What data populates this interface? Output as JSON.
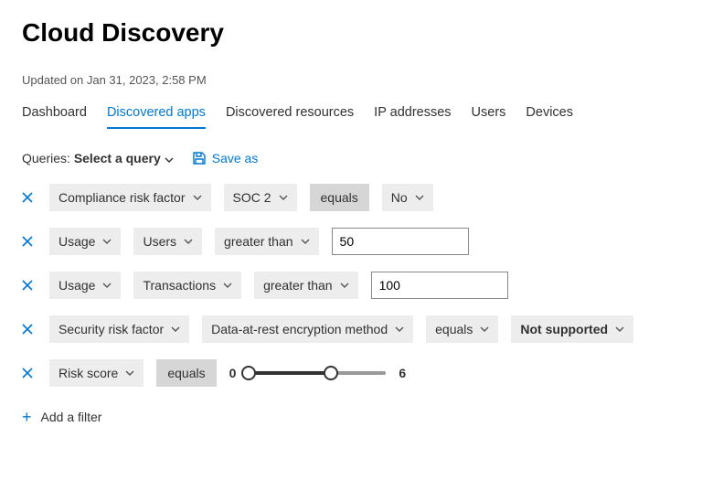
{
  "page_title": "Cloud Discovery",
  "updated_text": "Updated on Jan 31, 2023, 2:58 PM",
  "tabs": [
    {
      "label": "Dashboard",
      "active": false
    },
    {
      "label": "Discovered apps",
      "active": true
    },
    {
      "label": "Discovered resources",
      "active": false
    },
    {
      "label": "IP addresses",
      "active": false
    },
    {
      "label": "Users",
      "active": false
    },
    {
      "label": "Devices",
      "active": false
    }
  ],
  "queries": {
    "label": "Queries:",
    "select_label": "Select a query",
    "save_as_label": "Save as"
  },
  "filters": [
    {
      "field": "Compliance risk factor",
      "subfield": "SOC 2",
      "operator": "equals",
      "value_type": "chip",
      "value": "No"
    },
    {
      "field": "Usage",
      "subfield": "Users",
      "operator": "greater than",
      "value_type": "text",
      "value": "50"
    },
    {
      "field": "Usage",
      "subfield": "Transactions",
      "operator": "greater than",
      "value_type": "text",
      "value": "100"
    },
    {
      "field": "Security risk factor",
      "subfield": "Data-at-rest encryption method",
      "operator": "equals",
      "value_type": "chip",
      "value": "Not supported"
    },
    {
      "field": "Risk score",
      "subfield": null,
      "operator": "equals",
      "value_type": "range",
      "range": {
        "low": 0,
        "high": 6,
        "min": 0,
        "max": 10
      }
    }
  ],
  "add_filter_label": "Add a filter"
}
